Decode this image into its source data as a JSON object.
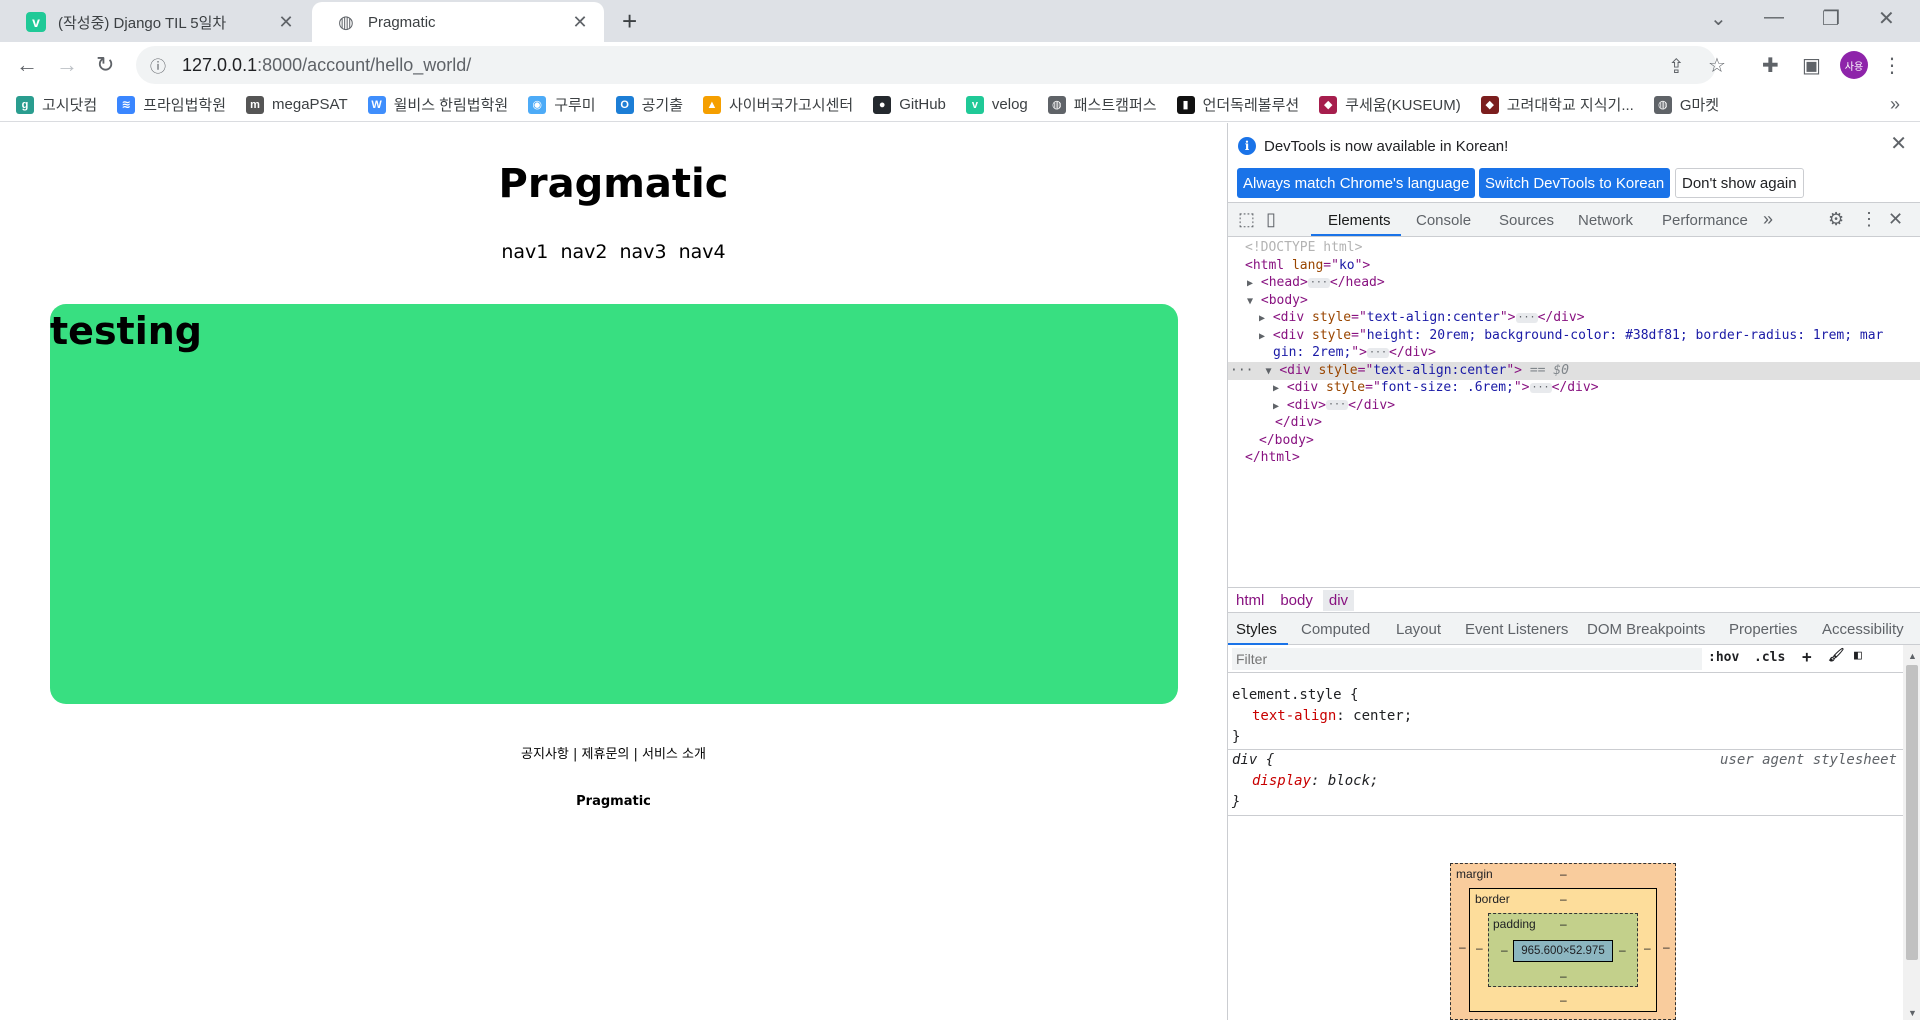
{
  "browser": {
    "tabs": [
      {
        "title": "(작성중) Django TIL 5일차",
        "favicon_text": "v",
        "favicon_color": "#20c997"
      },
      {
        "title": "Pragmatic",
        "favicon_text": "◍",
        "favicon_color": "#5f6368"
      }
    ],
    "url_host": "127.0.0.1",
    "url_path": ":8000/account/hello_world/",
    "profile_initials": "사용",
    "bookmarks": [
      {
        "label": "고시닷컴",
        "icon": "g",
        "color": "#2a9d8f"
      },
      {
        "label": "프라임법학원",
        "icon": "≋",
        "color": "#3a86ff"
      },
      {
        "label": "megaPSAT",
        "icon": "m",
        "color": "#555555"
      },
      {
        "label": "윌비스 한림법학원",
        "icon": "W",
        "color": "#3f8efc"
      },
      {
        "label": "구루미",
        "icon": "◉",
        "color": "#4dabf7"
      },
      {
        "label": "공기출",
        "icon": "O",
        "color": "#1c7ed6"
      },
      {
        "label": "사이버국가고시센터",
        "icon": "▲",
        "color": "#f59f00"
      },
      {
        "label": "GitHub",
        "icon": "●",
        "color": "#24292e"
      },
      {
        "label": "velog",
        "icon": "v",
        "color": "#20c997"
      },
      {
        "label": "패스트캠퍼스",
        "icon": "◍",
        "color": "#5f6368"
      },
      {
        "label": "언더독레볼루션",
        "icon": "▮",
        "color": "#111111"
      },
      {
        "label": "쿠세움(KUSEUM)",
        "icon": "◆",
        "color": "#a61e4d"
      },
      {
        "label": "고려대학교 지식기...",
        "icon": "◆",
        "color": "#7b1e1e"
      },
      {
        "label": "G마켓",
        "icon": "◍",
        "color": "#5f6368"
      }
    ]
  },
  "page": {
    "title": "Pragmatic",
    "nav": [
      "nav1",
      "nav2",
      "nav3",
      "nav4"
    ],
    "box_heading": "testing",
    "box_color": "#38df81",
    "footer_links": "공지사항 | 제휴문의 | 서비스 소개",
    "footer_brand": "Pragmatic"
  },
  "devtools": {
    "banner_message": "DevTools is now available in Korean!",
    "btn_match": "Always match Chrome's language",
    "btn_switch": "Switch DevTools to Korean",
    "btn_dont_show": "Don't show again",
    "tabs": [
      "Elements",
      "Console",
      "Sources",
      "Network",
      "Performance"
    ],
    "dom": {
      "doctype": "<!DOCTYPE html>",
      "html_lang": "ko",
      "head_tag": "head",
      "body_tag": "body",
      "div1_style": "text-align:center",
      "div2_style_a": "height: 20rem; background-color: #38df81; border-radius: 1rem; mar",
      "div2_style_b": "gin: 2rem;",
      "div3_style": "text-align:center",
      "div3_eq": "== $0",
      "div4_style": "font-size: .6rem;"
    },
    "breadcrumb": [
      "html",
      "body",
      "div"
    ],
    "style_tabs": [
      "Styles",
      "Computed",
      "Layout",
      "Event Listeners",
      "DOM Breakpoints",
      "Properties",
      "Accessibility"
    ],
    "filter_placeholder": "Filter",
    "filter_hov": ":hov",
    "filter_cls": ".cls",
    "rules": {
      "r1_selector": "element.style {",
      "r1_prop": "text-align",
      "r1_val": "center;",
      "r2_selector": "div {",
      "r2_source": "user agent stylesheet",
      "r2_prop": "display",
      "r2_val": "block;"
    },
    "boxmodel": {
      "margin_label": "margin",
      "border_label": "border",
      "padding_label": "padding",
      "dash": "–",
      "content": "965.600×52.975"
    }
  }
}
